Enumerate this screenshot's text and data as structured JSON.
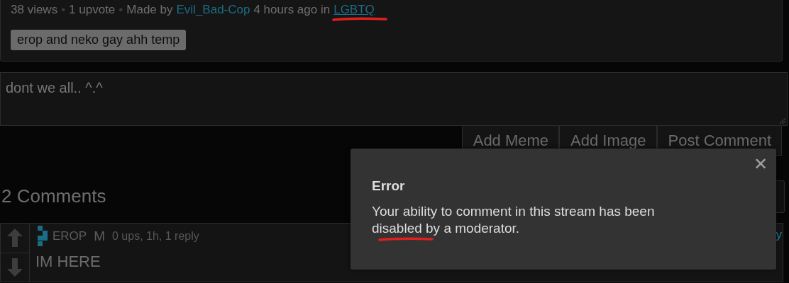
{
  "post_meta": {
    "views": "38 views",
    "sep": "•",
    "upvotes": "1 upvote",
    "made_by": "Made by",
    "author": "Evil_Bad-Cop",
    "time": "4 hours ago in",
    "stream": "LGBTQ"
  },
  "tags": [
    "erop and neko gay ahh temp"
  ],
  "comment_box": {
    "value": "dont we all.. ^.^"
  },
  "buttons": [
    "Add Meme",
    "Add Image",
    "Post Comment"
  ],
  "comments_heading": "2 Comments",
  "comments": [
    {
      "username": "EROP",
      "badge": "M",
      "meta": "0 ups, 1h, 1 reply",
      "text": "IM HERE",
      "link": "y"
    }
  ],
  "dialog": {
    "title": "Error",
    "message": "Your ability to comment in this stream has been disabled by a moderator.",
    "close": "✕"
  }
}
